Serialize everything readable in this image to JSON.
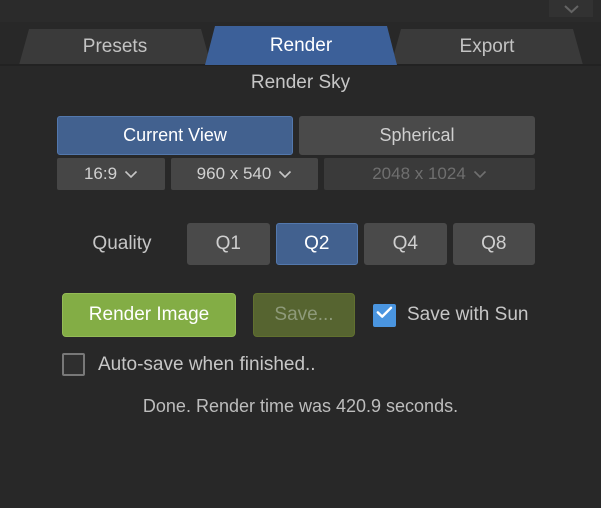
{
  "window": {
    "collapse_icon": "chevron-down-icon"
  },
  "tabs": [
    {
      "label": "Presets",
      "active": false
    },
    {
      "label": "Render",
      "active": true
    },
    {
      "label": "Export",
      "active": false
    }
  ],
  "panel": {
    "title": "Render Sky"
  },
  "projection": {
    "current_view_label": "Current View",
    "spherical_label": "Spherical",
    "current_view_selected": true,
    "aspect_ratio": {
      "value": "16:9",
      "caret_icon": "chevron-down-icon",
      "enabled": true
    },
    "resolution": {
      "value": "960 x 540",
      "caret_icon": "chevron-down-icon",
      "enabled": true
    },
    "spherical_resolution": {
      "value": "2048 x 1024",
      "caret_icon": "chevron-down-icon",
      "enabled": false
    }
  },
  "quality": {
    "label": "Quality",
    "options": [
      {
        "label": "Q1",
        "selected": false
      },
      {
        "label": "Q2",
        "selected": true
      },
      {
        "label": "Q4",
        "selected": false
      },
      {
        "label": "Q8",
        "selected": false
      }
    ]
  },
  "actions": {
    "render_label": "Render Image",
    "save_label": "Save...",
    "save_enabled": false,
    "save_with_sun": {
      "label": "Save with Sun",
      "checked": true,
      "check_icon": "checkmark-icon"
    },
    "auto_save": {
      "label": "Auto-save when finished..",
      "checked": false
    }
  },
  "status": {
    "message": "Done. Render time was 420.9 seconds."
  },
  "colors": {
    "background": "#282828",
    "accent_blue": "#3c6099",
    "button_blue": "#42618f",
    "checkbox_blue": "#4a95e0",
    "render_green": "#83ad45",
    "save_green_disabled": "#566430",
    "control_gray": "#4a4a4a"
  }
}
